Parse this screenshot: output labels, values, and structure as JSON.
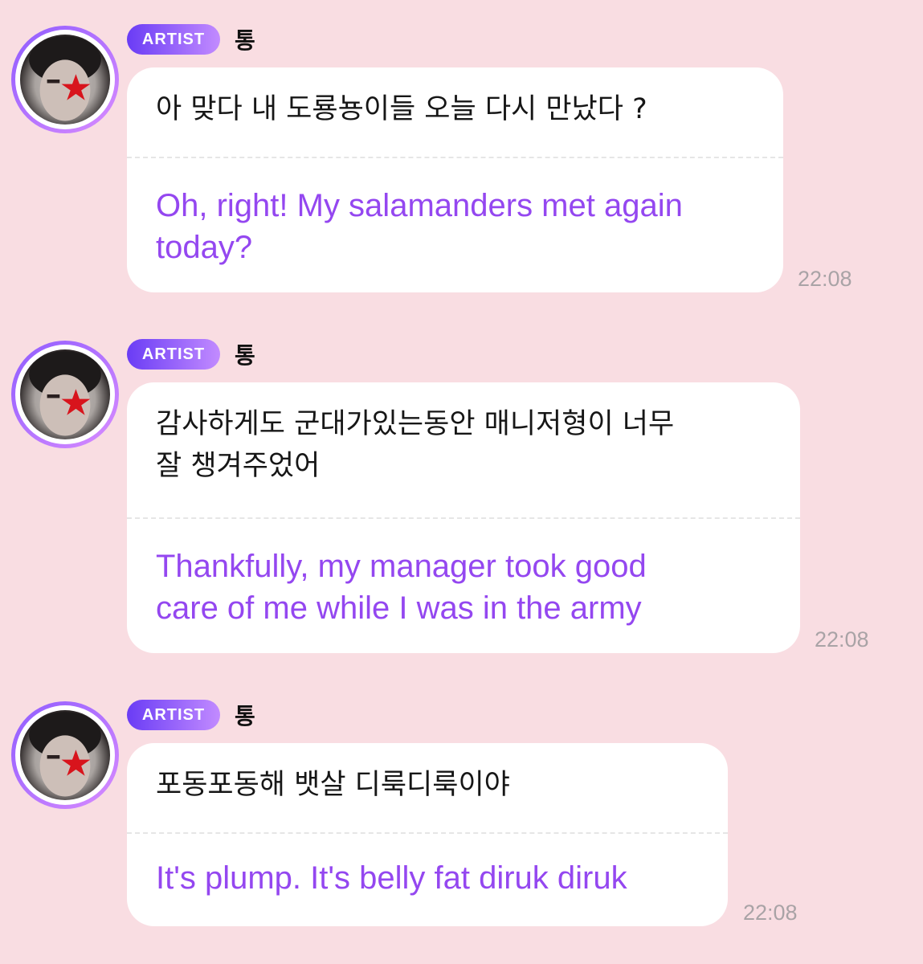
{
  "messages": [
    {
      "badge": "ARTIST",
      "sender": "통",
      "korean": "아 맞다 내 도룡뇽이들 오늘 다시 만났다 ?",
      "english": "Oh, right! My salamanders met again\ntoday?",
      "time": "22:08"
    },
    {
      "badge": "ARTIST",
      "sender": "통",
      "korean": "감사하게도 군대가있는동안 매니저형이 너무\n잘 챙겨주었어",
      "english": "Thankfully, my manager took good\ncare of me while I was in the army",
      "time": "22:08"
    },
    {
      "badge": "ARTIST",
      "sender": "통",
      "korean": "포동포동해 뱃살 디룩디룩이야",
      "english": "It's plump. It's belly fat diruk diruk",
      "time": "22:08"
    }
  ],
  "colors": {
    "background": "#f9dde2",
    "badge_start": "#6a3cf5",
    "badge_end": "#c28bff",
    "translation": "#9447f0",
    "timestamp": "#a9a3a6"
  },
  "icons": {
    "avatar": "profile-photo-red-star"
  }
}
